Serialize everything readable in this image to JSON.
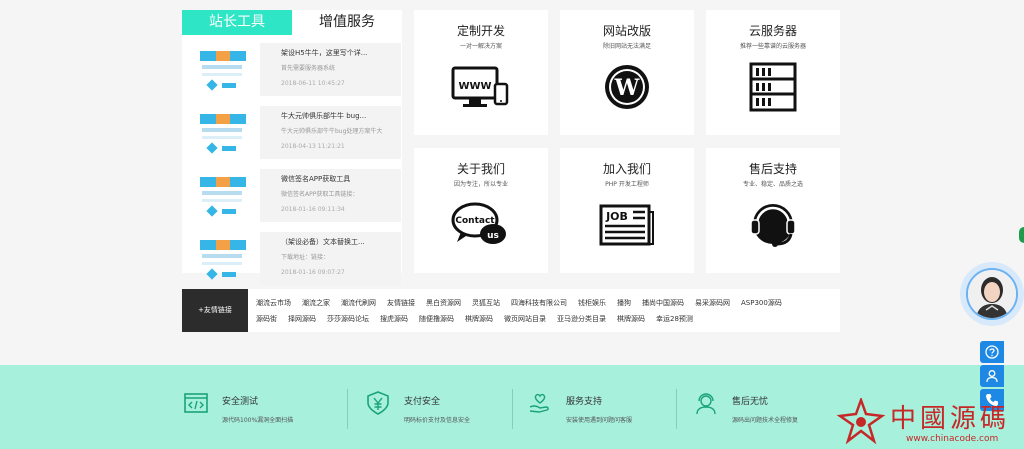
{
  "tabs": {
    "active": "站长工具",
    "inactive": "增值服务"
  },
  "news": [
    {
      "title": "架设H5牛牛，这里写个详...",
      "desc": "首先需要服务器系统",
      "date": "2018-06-11 10:45:27"
    },
    {
      "title": "牛大元帅俱乐部牛牛 bug...",
      "desc": "牛大元帅俱乐部牛牛bug处理方案牛大",
      "date": "2018-04-13 11:21:21"
    },
    {
      "title": "微信签名APP获取工具",
      "desc": "微信签名APP获取工具链接：",
      "date": "2018-01-16 09:11:34"
    },
    {
      "title": "（架设必备）文本替换工...",
      "desc": "下载地址：链接：",
      "date": "2018-01-16 09:07:27"
    }
  ],
  "services": [
    {
      "title": "定制开发",
      "subtitle": "一对一解决方案",
      "icon": "www-monitor-icon",
      "icon_text": "WWW"
    },
    {
      "title": "网站改版",
      "subtitle": "除旧网站无法满足",
      "icon": "wordpress-icon",
      "icon_text": "W"
    },
    {
      "title": "云服务器",
      "subtitle": "推荐一些靠谱的云服务器",
      "icon": "server-rack-icon",
      "icon_text": ""
    },
    {
      "title": "关于我们",
      "subtitle": "因为专注，所以专业",
      "icon": "contact-us-icon",
      "icon_text": "Contact",
      "icon_text2": "us"
    },
    {
      "title": "加入我们",
      "subtitle": "PHP 开发工程师",
      "icon": "job-newspaper-icon",
      "icon_text": "JOB"
    },
    {
      "title": "售后支持",
      "subtitle": "专业、稳定、品质之选",
      "icon": "headset-icon",
      "icon_text": ""
    }
  ],
  "links": {
    "label": "+友情链接",
    "row1": [
      "潮流云市场",
      "潮流之家",
      "潮流代刷网",
      "友情链接",
      "黑白资源网",
      "灵狐互站",
      "四海科技有限公司",
      "钱柜娱乐",
      "播狗",
      "捕尚中国源码",
      "易采源码网",
      "ASP300源码"
    ],
    "row2": [
      "源码街",
      "择网源码",
      "莎莎源码论坛",
      "搜虎源码",
      "随便撸源码",
      "棋牌源码",
      "微页网站目录",
      "亚马逊分类目录",
      "棋牌源码",
      "幸运28预测"
    ]
  },
  "features": [
    {
      "title": "安全测试",
      "desc": "源代码100%漏洞全面扫描",
      "icon": "code-window-icon"
    },
    {
      "title": "支付安全",
      "desc": "明码标价支付及信息安全",
      "icon": "yuan-shield-icon"
    },
    {
      "title": "服务支持",
      "desc": "安装使用遇到问题问客服",
      "icon": "heart-hand-icon"
    },
    {
      "title": "售后无忧",
      "desc": "源码出问题技术全程修复",
      "icon": "support-agent-icon"
    }
  ],
  "watermark": {
    "text": "中國源碼",
    "url": "www.chinacode.com"
  },
  "colors": {
    "accent": "#2ee6c6",
    "footer": "#a7f0dc",
    "sidebar": "#1e88e5",
    "watermark": "#c62828"
  }
}
